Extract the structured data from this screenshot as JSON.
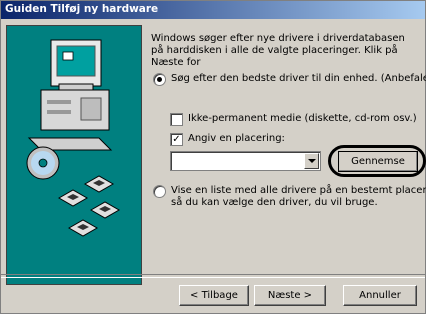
{
  "window": {
    "title": "Guiden Tilføj ny hardware"
  },
  "intro": "Windows søger efter nye drivere i driverdatabasen på harddisken i alle de valgte placeringer. Klik på Næste for",
  "radios": {
    "search": {
      "label": "Søg efter den bedste driver til din enhed. (Anbefales).",
      "selected": true
    },
    "list": {
      "line1": "Vise en liste med alle drivere på en bestemt placering,",
      "line2": "så du kan vælge den driver, du vil bruge.",
      "selected": false
    }
  },
  "checks": {
    "removable": {
      "label": "Ikke-permanent medie (diskette, cd-rom osv.)",
      "checked": false
    },
    "location": {
      "label": "Angiv en placering:",
      "checked": true
    }
  },
  "location_value": "",
  "buttons": {
    "browse": "Gennemse",
    "back": "< Tilbage",
    "next": "Næste >",
    "cancel": "Annuller"
  },
  "icons": {
    "computer": "computer-icon",
    "cd": "cd-icon",
    "floppy": "floppy-disk-icon",
    "dropdown": "chevron-down-icon"
  }
}
